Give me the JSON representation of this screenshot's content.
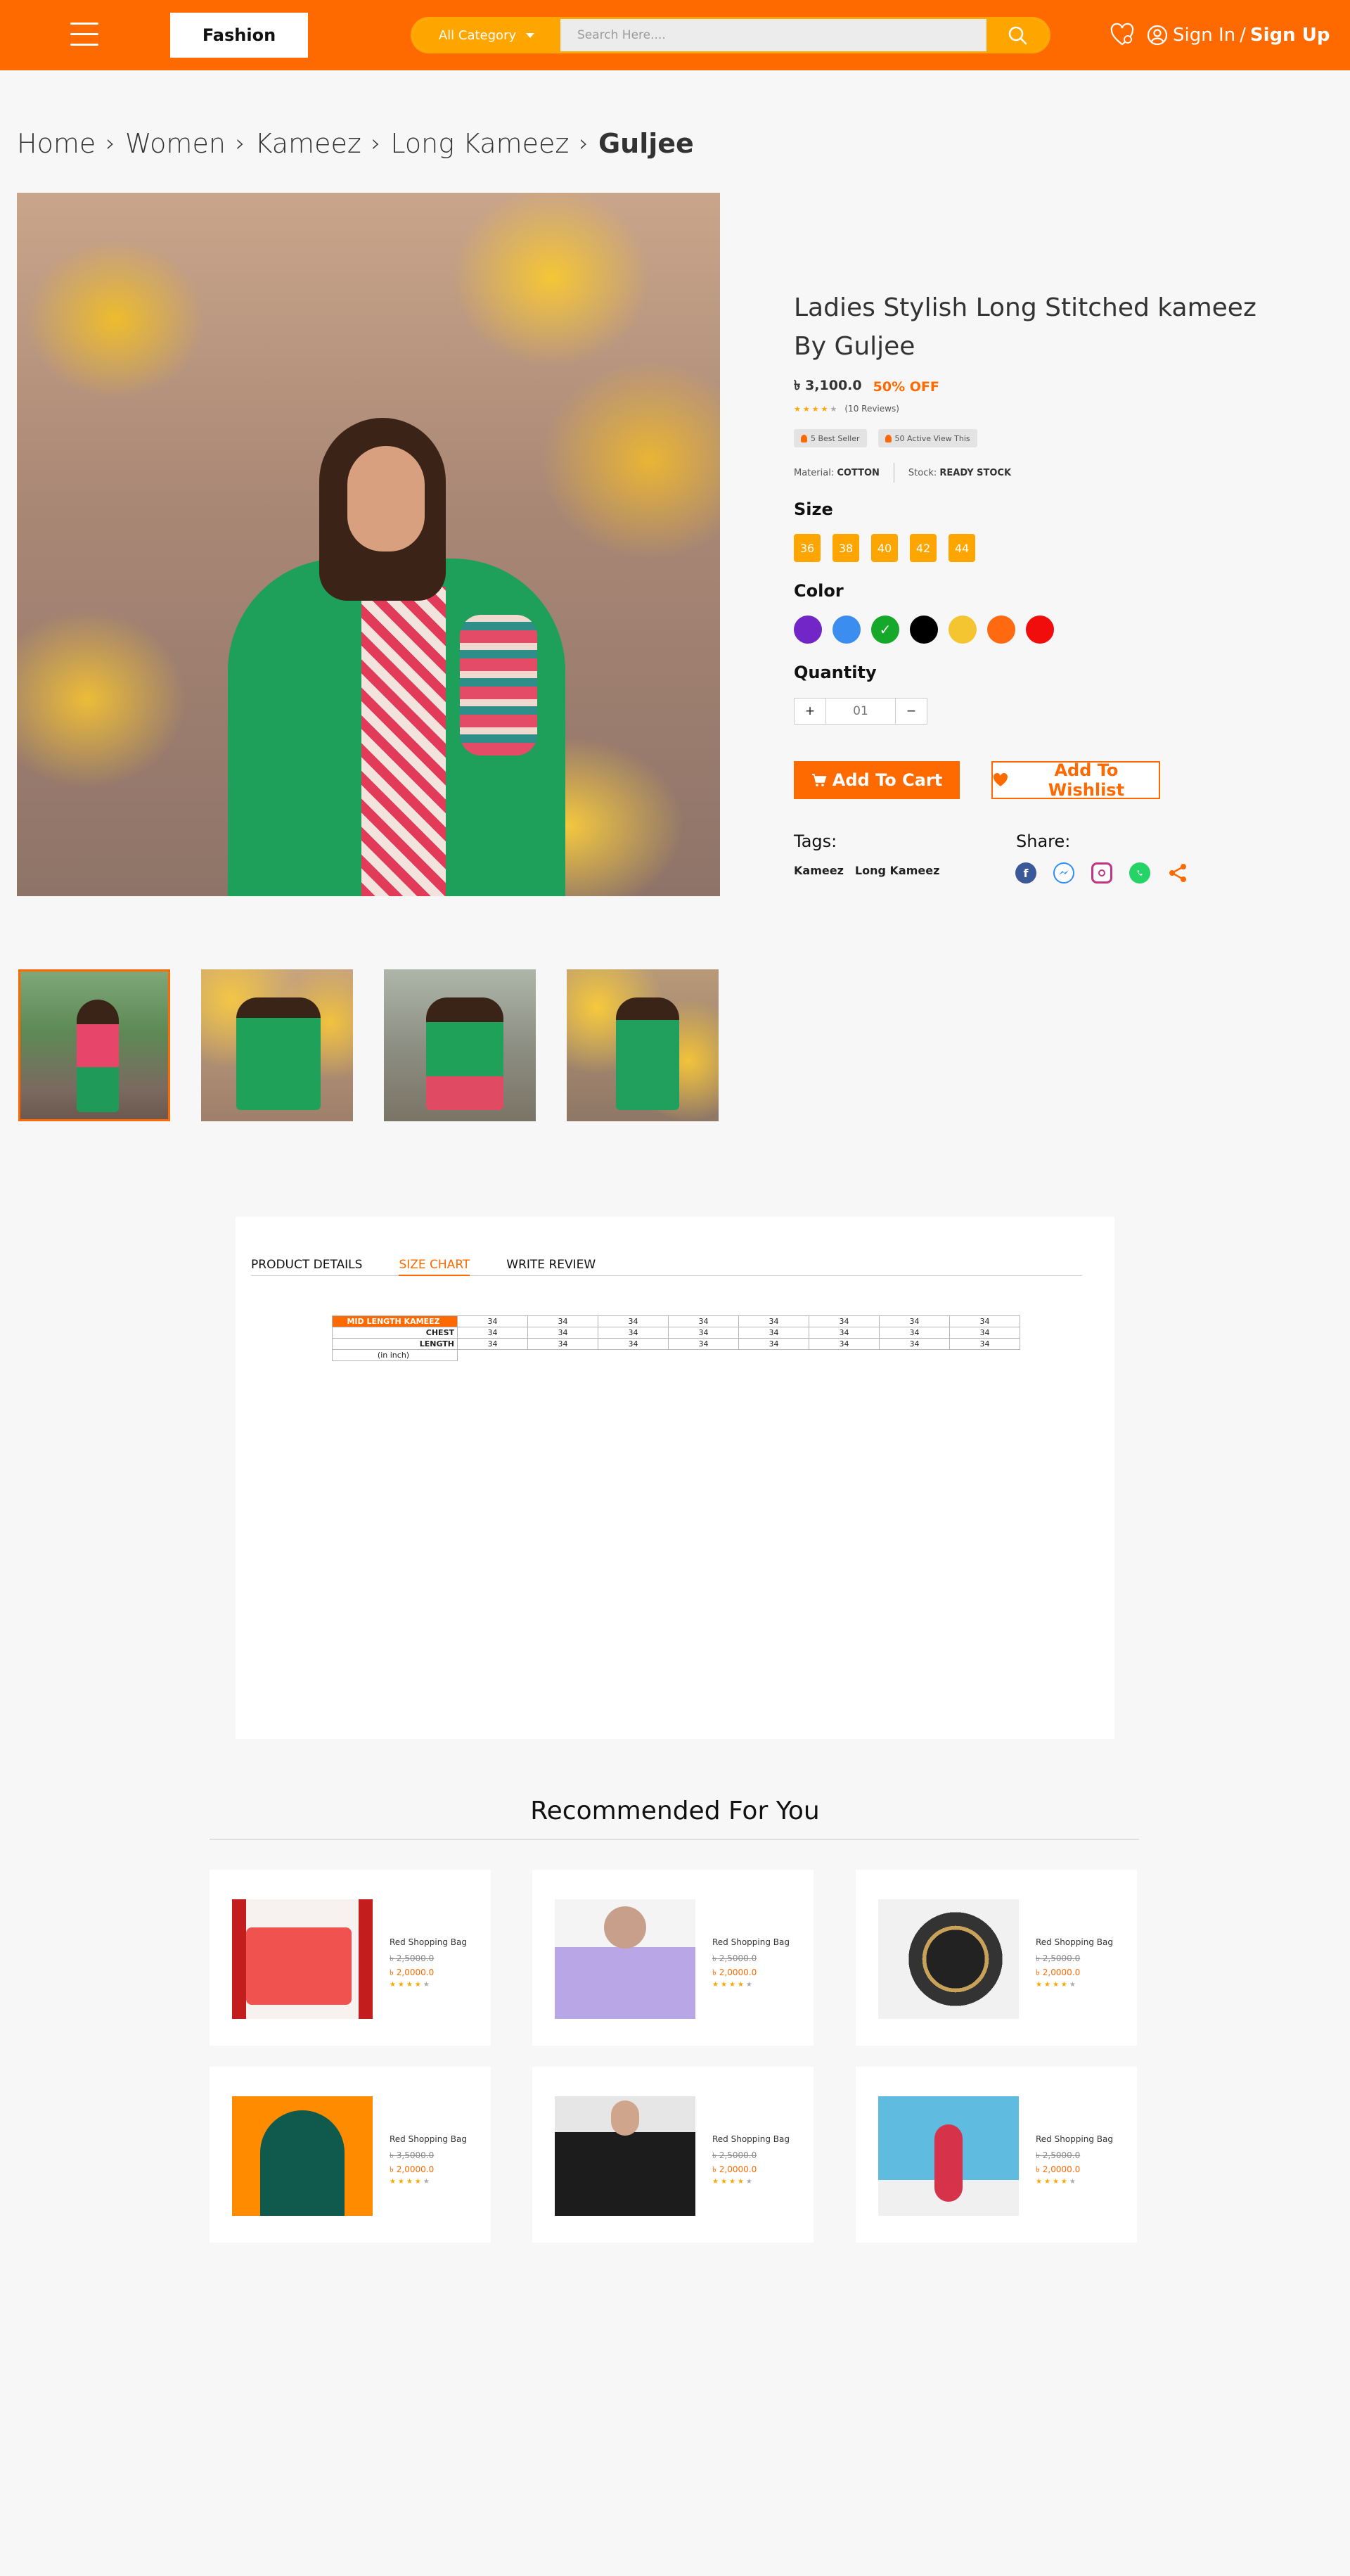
{
  "header": {
    "logo": "Fashion",
    "category_label": "All Category",
    "search_placeholder": "Search Here....",
    "sign_in": "Sign In",
    "slash": "/",
    "sign_up": "Sign Up"
  },
  "breadcrumb": [
    {
      "label": "Home"
    },
    {
      "label": "Women"
    },
    {
      "label": "Kameez"
    },
    {
      "label": "Long Kameez"
    }
  ],
  "breadcrumb_current": "Guljee",
  "breadcrumb_sep": "›",
  "product": {
    "title": "Ladies Stylish Long Stitched kameez By Guljee",
    "price": "৳ 3,100.0",
    "discount": "50% OFF",
    "rating": 4,
    "rating_max": 5,
    "reviews": "(10 Reviews)",
    "badge_best_seller": "5 Best Seller",
    "badge_active_view": "50 Active View This",
    "material_label": "Material:",
    "material_value": "COTTON",
    "stock_label": "Stock:",
    "stock_value": "READY STOCK",
    "size_label": "Size",
    "sizes": [
      "36",
      "38",
      "40",
      "42",
      "44"
    ],
    "color_label": "Color",
    "colors": [
      "#7226c8",
      "#3b8ef0",
      "#15a82a",
      "#000000",
      "#f5c531",
      "#ff6a10",
      "#f20d0d"
    ],
    "selected_color_index": 2,
    "quantity_label": "Quantity",
    "quantity_plus": "+",
    "quantity_minus": "−",
    "quantity_value": "01",
    "add_to_cart": "Add To Cart",
    "add_to_wishlist": "Add To Wishlist",
    "tags_label": "Tags:",
    "tags": [
      "Kameez",
      "Long Kameez"
    ],
    "share_label": "Share:"
  },
  "tabs": [
    {
      "label": "PRODUCT DETAILS",
      "active": false
    },
    {
      "label": "SIZE CHART",
      "active": true
    },
    {
      "label": "WRITE REVIEW",
      "active": false
    }
  ],
  "size_chart": {
    "header": "MID LENGTH KAMEEZ",
    "rows": [
      {
        "label": "MID LENGTH KAMEEZ",
        "values": [
          "34",
          "34",
          "34",
          "34",
          "34",
          "34",
          "34",
          "34"
        ]
      },
      {
        "label": "CHEST",
        "values": [
          "34",
          "34",
          "34",
          "34",
          "34",
          "34",
          "34",
          "34"
        ]
      },
      {
        "label": "LENGTH",
        "values": [
          "34",
          "34",
          "34",
          "34",
          "34",
          "34",
          "34",
          "34"
        ]
      }
    ],
    "unit": "(in inch)"
  },
  "recommended": {
    "title": "Recommended For You",
    "items": [
      {
        "name": "Red Shopping Bag",
        "old_price": "৳ 2,5000.0",
        "price": "৳ 2,0000.0",
        "rating": 4
      },
      {
        "name": "Red Shopping Bag",
        "old_price": "৳ 2,5000.0",
        "price": "৳ 2,0000.0",
        "rating": 4
      },
      {
        "name": "Red Shopping Bag",
        "old_price": "৳ 2,5000.0",
        "price": "৳ 2,0000.0",
        "rating": 4
      },
      {
        "name": "Red Shopping Bag",
        "old_price": "৳ 3,5000.0",
        "price": "৳ 2,0000.0",
        "rating": 4
      },
      {
        "name": "Red Shopping Bag",
        "old_price": "৳ 2,5000.0",
        "price": "৳ 2,0000.0",
        "rating": 4
      },
      {
        "name": "Red Shopping Bag",
        "old_price": "৳ 2,5000.0",
        "price": "৳ 2,0000.0",
        "rating": 4
      }
    ]
  },
  "colors": {
    "brand_orange": "#ff6a00",
    "accent_amber": "#ffa500"
  },
  "icons": {
    "menu": "hamburger-icon",
    "search": "search-icon",
    "wishlist": "heart-icon",
    "user": "user-icon",
    "cart": "cart-icon",
    "share": [
      "facebook-icon",
      "messenger-icon",
      "instagram-icon",
      "whatsapp-icon",
      "share-icon"
    ]
  }
}
